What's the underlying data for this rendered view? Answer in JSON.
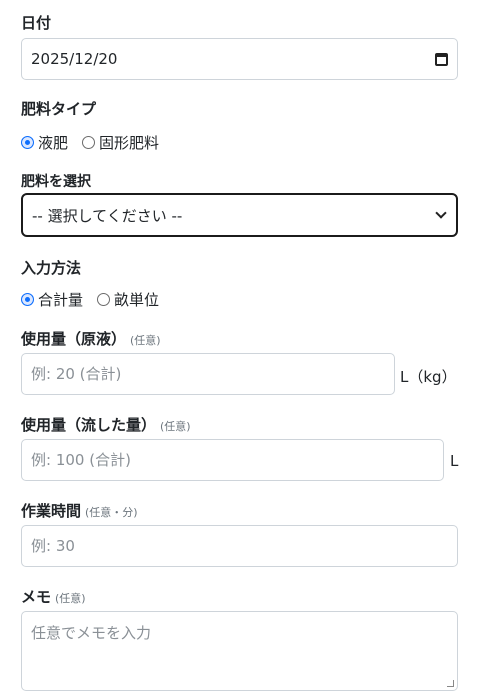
{
  "date": {
    "label": "日付",
    "value": "2025/12/20"
  },
  "fertilizer_type": {
    "label": "肥料タイプ",
    "options": [
      "液肥",
      "固形肥料"
    ],
    "selected": "液肥"
  },
  "fertilizer_select": {
    "label": "肥料を選択",
    "value": "-- 選択してください --"
  },
  "input_method": {
    "label": "入力方法",
    "options": [
      "合計量",
      "畝単位"
    ],
    "selected": "合計量"
  },
  "usage_raw": {
    "label": "使用量（原液）",
    "hint": "(任意)",
    "placeholder": "例: 20 (合計)",
    "unit": "L（kg）"
  },
  "usage_flow": {
    "label": "使用量（流した量）",
    "hint": "(任意)",
    "placeholder": "例: 100 (合計)",
    "unit": "L"
  },
  "work_time": {
    "label": "作業時間",
    "hint": "(任意・分)",
    "placeholder": "例: 30"
  },
  "memo": {
    "label": "メモ",
    "hint": "(任意)",
    "placeholder": "任意でメモを入力"
  },
  "colors": {
    "accent": "#0d6efd",
    "border": "#ced4da",
    "text": "#212529",
    "hint": "#6c757d"
  }
}
